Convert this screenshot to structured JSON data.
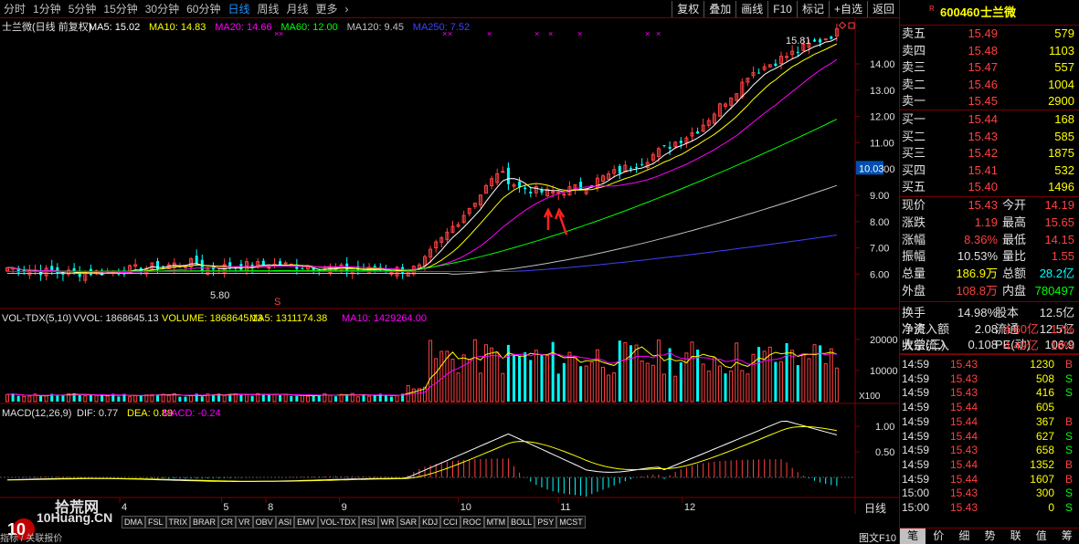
{
  "toolbar": {
    "periods": [
      "分时",
      "1分钟",
      "5分钟",
      "15分钟",
      "30分钟",
      "60分钟",
      "日线",
      "周线",
      "月线",
      "更多"
    ],
    "active": "日线",
    "buttons": [
      "复权",
      "叠加",
      "画线",
      "F10",
      "标记",
      "+自选",
      "返回"
    ]
  },
  "main_header": {
    "title": "士兰微(日线 前复权)",
    "ma": [
      {
        "label": "MA5: 15.02",
        "color": "#ffffff"
      },
      {
        "label": "MA10: 14.83",
        "color": "#ffff00"
      },
      {
        "label": "MA20: 14.66",
        "color": "#ff00ff"
      },
      {
        "label": "MA60: 12.00",
        "color": "#00ff00"
      },
      {
        "label": "MA120: 9.45",
        "color": "#c0c0c0"
      },
      {
        "label": "MA250: 7.52",
        "color": "#4040ff"
      }
    ]
  },
  "price_axis": [
    "14.00",
    "13.00",
    "12.00",
    "11.00",
    "10.00",
    "9.00",
    "8.00",
    "7.00",
    "6.00"
  ],
  "current_price_tag": "10.03",
  "annotations": {
    "high": "15.81",
    "low": "5.80",
    "s_marker": "S"
  },
  "volume_header": {
    "name": "VOL-TDX(5,10)",
    "vvol": "VVOL: 1868645.13",
    "volume": "VOLUME: 1868645.13",
    "ma5": "MA5: 1311174.38",
    "ma10": "MA10: 1429264.00"
  },
  "volume_axis": [
    "20000",
    "10000"
  ],
  "volume_unit": "X100",
  "macd_header": {
    "name": "MACD(12,26,9)",
    "dif": "DIF: 0.77",
    "dea": "DEA: 0.89",
    "macd": "MACD: -0.24"
  },
  "macd_axis": [
    "1.00",
    "0.50"
  ],
  "months": [
    {
      "label": "4",
      "pos": 0.14
    },
    {
      "label": "5",
      "pos": 0.259
    },
    {
      "label": "8",
      "pos": 0.311
    },
    {
      "label": "9",
      "pos": 0.397
    },
    {
      "label": "10",
      "pos": 0.536
    },
    {
      "label": "11",
      "pos": 0.653
    },
    {
      "label": "12",
      "pos": 0.798
    }
  ],
  "period_label": "日线",
  "indicators": [
    "DMA",
    "FSL",
    "TRIX",
    "BRAR",
    "CR",
    "VR",
    "OBV",
    "ASI",
    "EMV",
    "VOL-TDX",
    "RSI",
    "WR",
    "SAR",
    "KDJ",
    "CCI",
    "ROC",
    "MTM",
    "BOLL",
    "PSY",
    "MCST"
  ],
  "bottom_left": "指标 / 关联报价",
  "f10_label": "图文F10",
  "watermark": {
    "cn": "拾荒网",
    "en": "10Huang.CN"
  },
  "stock": {
    "code": "600460",
    "name": "士兰微",
    "flag": "R"
  },
  "asks": [
    {
      "label": "卖五",
      "price": "15.49",
      "vol": "579"
    },
    {
      "label": "卖四",
      "price": "15.48",
      "vol": "1103"
    },
    {
      "label": "卖三",
      "price": "15.47",
      "vol": "557"
    },
    {
      "label": "卖二",
      "price": "15.46",
      "vol": "1004"
    },
    {
      "label": "卖一",
      "price": "15.45",
      "vol": "2900"
    }
  ],
  "bids": [
    {
      "label": "买一",
      "price": "15.44",
      "vol": "168"
    },
    {
      "label": "买二",
      "price": "15.43",
      "vol": "585"
    },
    {
      "label": "买三",
      "price": "15.42",
      "vol": "1875"
    },
    {
      "label": "买四",
      "price": "15.41",
      "vol": "532"
    },
    {
      "label": "买五",
      "price": "15.40",
      "vol": "1496"
    }
  ],
  "quote": [
    {
      "l1": "现价",
      "v1": "15.43",
      "c1": "#ff4040",
      "l2": "今开",
      "v2": "14.19",
      "c2": "#ff4040"
    },
    {
      "l1": "涨跌",
      "v1": "1.19",
      "c1": "#ff4040",
      "l2": "最高",
      "v2": "15.65",
      "c2": "#ff4040"
    },
    {
      "l1": "涨幅",
      "v1": "8.36%",
      "c1": "#ff4040",
      "l2": "最低",
      "v2": "14.15",
      "c2": "#ff4040"
    },
    {
      "l1": "振幅",
      "v1": "10.53%",
      "c1": "#e0e0e0",
      "l2": "量比",
      "v2": "1.55",
      "c2": "#ff4040"
    },
    {
      "l1": "总量",
      "v1": "186.9万",
      "c1": "#ffff00",
      "l2": "总额",
      "v2": "28.2亿",
      "c2": "#00ffff"
    },
    {
      "l1": "外盘",
      "v1": "108.8万",
      "c1": "#ff4040",
      "l2": "内盘",
      "v2": "780497",
      "c2": "#00ff00"
    }
  ],
  "fundamentals": [
    {
      "l1": "换手",
      "v1": "14.98%",
      "l2": "股本",
      "v2": "12.5亿"
    },
    {
      "l1": "净资",
      "v1": "2.08",
      "l2": "流通",
      "v2": "12.5亿"
    },
    {
      "l1": "收益(三)",
      "v1": "0.108",
      "l2": "PE(动)",
      "v2": "106.9"
    }
  ],
  "flows": [
    {
      "label": "净流入额",
      "value": "4.60亿",
      "pct": "17%"
    },
    {
      "label": "大宗流入",
      "value": "4.49亿",
      "pct": "16%"
    }
  ],
  "ticks": [
    {
      "time": "14:59",
      "price": "15.43",
      "vol": "1230",
      "side": "B"
    },
    {
      "time": "14:59",
      "price": "15.43",
      "vol": "508",
      "side": "S"
    },
    {
      "time": "14:59",
      "price": "15.43",
      "vol": "416",
      "side": "S"
    },
    {
      "time": "14:59",
      "price": "15.44",
      "vol": "605",
      "side": ""
    },
    {
      "time": "14:59",
      "price": "15.44",
      "vol": "367",
      "side": "B"
    },
    {
      "time": "14:59",
      "price": "15.44",
      "vol": "627",
      "side": "S"
    },
    {
      "time": "14:59",
      "price": "15.43",
      "vol": "658",
      "side": "S"
    },
    {
      "time": "14:59",
      "price": "15.44",
      "vol": "1352",
      "side": "B"
    },
    {
      "time": "14:59",
      "price": "15.44",
      "vol": "1607",
      "side": "B"
    },
    {
      "time": "15:00",
      "price": "15.43",
      "vol": "300",
      "side": "S"
    },
    {
      "time": "15:00",
      "price": "15.43",
      "vol": "0",
      "side": "S"
    }
  ],
  "right_tabs": [
    "笔",
    "价",
    "细",
    "势",
    "联",
    "值",
    "筹"
  ],
  "colors": {
    "up": "#ff4040",
    "down": "#00ffff",
    "grid": "#7a0000"
  }
}
